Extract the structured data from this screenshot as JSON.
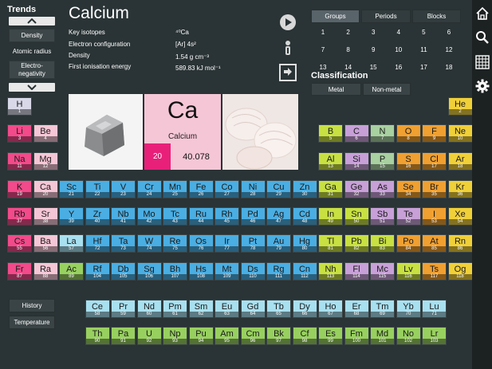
{
  "trends": {
    "title": "Trends",
    "items": [
      "Density",
      "Atomic radius",
      "Electro-negativity"
    ]
  },
  "element": {
    "name": "Calcium",
    "symbol": "Ca",
    "atomic_number": "20",
    "atomic_mass": "40.078",
    "info": [
      {
        "label": "Key isotopes",
        "value": "⁴⁰Ca"
      },
      {
        "label": "Electron configuration",
        "value": "[Ar] 4s²"
      },
      {
        "label": "Density",
        "value": "1.54 g cm⁻³"
      },
      {
        "label": "First ionisation energy",
        "value": "589.83 kJ mol⁻¹"
      }
    ]
  },
  "tabs": [
    "Groups",
    "Periods",
    "Blocks"
  ],
  "active_tab": "Groups",
  "group_numbers": [
    "1",
    "2",
    "3",
    "4",
    "5",
    "6",
    "7",
    "8",
    "9",
    "10",
    "11",
    "12",
    "13",
    "14",
    "15",
    "16",
    "17",
    "18"
  ],
  "classification": {
    "title": "Classification",
    "buttons": [
      "Metal",
      "Non-metal"
    ]
  },
  "bottom_buttons": [
    "History",
    "Temperature"
  ],
  "colors": {
    "alkali": "#f24a8a",
    "alkaline": "#f5c6d6",
    "transition": "#4aaee3",
    "post_transition": "#c8e042",
    "metalloid": "#c8a0d8",
    "nonmetal": "#a8d0a0",
    "halogen": "#f0a030",
    "noble": "#f0d038",
    "lanthanide": "#a8e0f0",
    "actinide": "#98d060",
    "unknown": "#88c8c0",
    "hydrogen": "#d8d8e8"
  },
  "icons": [
    "home-icon",
    "search-icon",
    "grid-icon",
    "gear-icon",
    "play-icon",
    "info-icon",
    "swap-icon"
  ],
  "cells": [
    {
      "s": "H",
      "n": "1",
      "c": "hydrogen",
      "col": 1,
      "row": 1
    },
    {
      "s": "He",
      "n": "2",
      "c": "noble",
      "col": 18,
      "row": 1
    },
    {
      "s": "Li",
      "n": "3",
      "c": "alkali",
      "col": 1,
      "row": 2
    },
    {
      "s": "Be",
      "n": "4",
      "c": "alkaline",
      "col": 2,
      "row": 2
    },
    {
      "s": "B",
      "n": "5",
      "c": "post_transition",
      "col": 13,
      "row": 2
    },
    {
      "s": "C",
      "n": "6",
      "c": "metalloid",
      "col": 14,
      "row": 2
    },
    {
      "s": "N",
      "n": "7",
      "c": "nonmetal",
      "col": 15,
      "row": 2
    },
    {
      "s": "O",
      "n": "8",
      "c": "halogen",
      "col": 16,
      "row": 2
    },
    {
      "s": "F",
      "n": "9",
      "c": "halogen",
      "col": 17,
      "row": 2
    },
    {
      "s": "Ne",
      "n": "10",
      "c": "noble",
      "col": 18,
      "row": 2
    },
    {
      "s": "Na",
      "n": "11",
      "c": "alkali",
      "col": 1,
      "row": 3
    },
    {
      "s": "Mg",
      "n": "12",
      "c": "alkaline",
      "col": 2,
      "row": 3
    },
    {
      "s": "Al",
      "n": "13",
      "c": "post_transition",
      "col": 13,
      "row": 3
    },
    {
      "s": "Si",
      "n": "14",
      "c": "metalloid",
      "col": 14,
      "row": 3
    },
    {
      "s": "P",
      "n": "15",
      "c": "nonmetal",
      "col": 15,
      "row": 3
    },
    {
      "s": "S",
      "n": "16",
      "c": "halogen",
      "col": 16,
      "row": 3
    },
    {
      "s": "Cl",
      "n": "17",
      "c": "halogen",
      "col": 17,
      "row": 3
    },
    {
      "s": "Ar",
      "n": "18",
      "c": "noble",
      "col": 18,
      "row": 3
    },
    {
      "s": "K",
      "n": "19",
      "c": "alkali",
      "col": 1,
      "row": 4
    },
    {
      "s": "Ca",
      "n": "20",
      "c": "alkaline",
      "col": 2,
      "row": 4
    },
    {
      "s": "Sc",
      "n": "21",
      "c": "transition",
      "col": 3,
      "row": 4
    },
    {
      "s": "Ti",
      "n": "22",
      "c": "transition",
      "col": 4,
      "row": 4
    },
    {
      "s": "V",
      "n": "23",
      "c": "transition",
      "col": 5,
      "row": 4
    },
    {
      "s": "Cr",
      "n": "24",
      "c": "transition",
      "col": 6,
      "row": 4
    },
    {
      "s": "Mn",
      "n": "25",
      "c": "transition",
      "col": 7,
      "row": 4
    },
    {
      "s": "Fe",
      "n": "26",
      "c": "transition",
      "col": 8,
      "row": 4
    },
    {
      "s": "Co",
      "n": "27",
      "c": "transition",
      "col": 9,
      "row": 4
    },
    {
      "s": "Ni",
      "n": "28",
      "c": "transition",
      "col": 10,
      "row": 4
    },
    {
      "s": "Cu",
      "n": "29",
      "c": "transition",
      "col": 11,
      "row": 4
    },
    {
      "s": "Zn",
      "n": "30",
      "c": "transition",
      "col": 12,
      "row": 4
    },
    {
      "s": "Ga",
      "n": "31",
      "c": "post_transition",
      "col": 13,
      "row": 4
    },
    {
      "s": "Ge",
      "n": "32",
      "c": "metalloid",
      "col": 14,
      "row": 4
    },
    {
      "s": "As",
      "n": "33",
      "c": "metalloid",
      "col": 15,
      "row": 4
    },
    {
      "s": "Se",
      "n": "34",
      "c": "halogen",
      "col": 16,
      "row": 4
    },
    {
      "s": "Br",
      "n": "35",
      "c": "halogen",
      "col": 17,
      "row": 4
    },
    {
      "s": "Kr",
      "n": "36",
      "c": "noble",
      "col": 18,
      "row": 4
    },
    {
      "s": "Rb",
      "n": "37",
      "c": "alkali",
      "col": 1,
      "row": 5
    },
    {
      "s": "Sr",
      "n": "38",
      "c": "alkaline",
      "col": 2,
      "row": 5
    },
    {
      "s": "Y",
      "n": "39",
      "c": "transition",
      "col": 3,
      "row": 5
    },
    {
      "s": "Zr",
      "n": "40",
      "c": "transition",
      "col": 4,
      "row": 5
    },
    {
      "s": "Nb",
      "n": "41",
      "c": "transition",
      "col": 5,
      "row": 5
    },
    {
      "s": "Mo",
      "n": "42",
      "c": "transition",
      "col": 6,
      "row": 5
    },
    {
      "s": "Tc",
      "n": "43",
      "c": "transition",
      "col": 7,
      "row": 5
    },
    {
      "s": "Ru",
      "n": "44",
      "c": "transition",
      "col": 8,
      "row": 5
    },
    {
      "s": "Rh",
      "n": "45",
      "c": "transition",
      "col": 9,
      "row": 5
    },
    {
      "s": "Pd",
      "n": "46",
      "c": "transition",
      "col": 10,
      "row": 5
    },
    {
      "s": "Ag",
      "n": "47",
      "c": "transition",
      "col": 11,
      "row": 5
    },
    {
      "s": "Cd",
      "n": "48",
      "c": "transition",
      "col": 12,
      "row": 5
    },
    {
      "s": "In",
      "n": "49",
      "c": "post_transition",
      "col": 13,
      "row": 5
    },
    {
      "s": "Sn",
      "n": "50",
      "c": "post_transition",
      "col": 14,
      "row": 5
    },
    {
      "s": "Sb",
      "n": "51",
      "c": "metalloid",
      "col": 15,
      "row": 5
    },
    {
      "s": "Te",
      "n": "52",
      "c": "metalloid",
      "col": 16,
      "row": 5
    },
    {
      "s": "I",
      "n": "53",
      "c": "halogen",
      "col": 17,
      "row": 5
    },
    {
      "s": "Xe",
      "n": "54",
      "c": "noble",
      "col": 18,
      "row": 5
    },
    {
      "s": "Cs",
      "n": "55",
      "c": "alkali",
      "col": 1,
      "row": 6
    },
    {
      "s": "Ba",
      "n": "56",
      "c": "alkaline",
      "col": 2,
      "row": 6
    },
    {
      "s": "La",
      "n": "57",
      "c": "lanthanide",
      "col": 3,
      "row": 6
    },
    {
      "s": "Hf",
      "n": "72",
      "c": "transition",
      "col": 4,
      "row": 6
    },
    {
      "s": "Ta",
      "n": "73",
      "c": "transition",
      "col": 5,
      "row": 6
    },
    {
      "s": "W",
      "n": "74",
      "c": "transition",
      "col": 6,
      "row": 6
    },
    {
      "s": "Re",
      "n": "75",
      "c": "transition",
      "col": 7,
      "row": 6
    },
    {
      "s": "Os",
      "n": "76",
      "c": "transition",
      "col": 8,
      "row": 6
    },
    {
      "s": "Ir",
      "n": "77",
      "c": "transition",
      "col": 9,
      "row": 6
    },
    {
      "s": "Pt",
      "n": "78",
      "c": "transition",
      "col": 10,
      "row": 6
    },
    {
      "s": "Au",
      "n": "79",
      "c": "transition",
      "col": 11,
      "row": 6
    },
    {
      "s": "Hg",
      "n": "80",
      "c": "transition",
      "col": 12,
      "row": 6
    },
    {
      "s": "Tl",
      "n": "81",
      "c": "post_transition",
      "col": 13,
      "row": 6
    },
    {
      "s": "Pb",
      "n": "82",
      "c": "post_transition",
      "col": 14,
      "row": 6
    },
    {
      "s": "Bi",
      "n": "83",
      "c": "post_transition",
      "col": 15,
      "row": 6
    },
    {
      "s": "Po",
      "n": "84",
      "c": "halogen",
      "col": 16,
      "row": 6
    },
    {
      "s": "At",
      "n": "85",
      "c": "halogen",
      "col": 17,
      "row": 6
    },
    {
      "s": "Rn",
      "n": "86",
      "c": "noble",
      "col": 18,
      "row": 6
    },
    {
      "s": "Fr",
      "n": "87",
      "c": "alkali",
      "col": 1,
      "row": 7
    },
    {
      "s": "Ra",
      "n": "88",
      "c": "alkaline",
      "col": 2,
      "row": 7
    },
    {
      "s": "Ac",
      "n": "89",
      "c": "actinide",
      "col": 3,
      "row": 7
    },
    {
      "s": "Rf",
      "n": "104",
      "c": "transition",
      "col": 4,
      "row": 7
    },
    {
      "s": "Db",
      "n": "105",
      "c": "transition",
      "col": 5,
      "row": 7
    },
    {
      "s": "Sg",
      "n": "106",
      "c": "transition",
      "col": 6,
      "row": 7
    },
    {
      "s": "Bh",
      "n": "107",
      "c": "transition",
      "col": 7,
      "row": 7
    },
    {
      "s": "Hs",
      "n": "108",
      "c": "transition",
      "col": 8,
      "row": 7
    },
    {
      "s": "Mt",
      "n": "109",
      "c": "transition",
      "col": 9,
      "row": 7
    },
    {
      "s": "Ds",
      "n": "110",
      "c": "transition",
      "col": 10,
      "row": 7
    },
    {
      "s": "Rg",
      "n": "111",
      "c": "transition",
      "col": 11,
      "row": 7
    },
    {
      "s": "Cn",
      "n": "112",
      "c": "transition",
      "col": 12,
      "row": 7
    },
    {
      "s": "Nh",
      "n": "113",
      "c": "post_transition",
      "col": 13,
      "row": 7
    },
    {
      "s": "Fl",
      "n": "114",
      "c": "metalloid",
      "col": 14,
      "row": 7
    },
    {
      "s": "Mc",
      "n": "115",
      "c": "metalloid",
      "col": 15,
      "row": 7
    },
    {
      "s": "Lv",
      "n": "116",
      "c": "post_transition",
      "col": 16,
      "row": 7
    },
    {
      "s": "Ts",
      "n": "117",
      "c": "halogen",
      "col": 17,
      "row": 7
    },
    {
      "s": "Og",
      "n": "118",
      "c": "noble",
      "col": 18,
      "row": 7
    },
    {
      "s": "Ce",
      "n": "58",
      "c": "lanthanide",
      "col": 4,
      "row": 9
    },
    {
      "s": "Pr",
      "n": "59",
      "c": "lanthanide",
      "col": 5,
      "row": 9
    },
    {
      "s": "Nd",
      "n": "60",
      "c": "lanthanide",
      "col": 6,
      "row": 9
    },
    {
      "s": "Pm",
      "n": "61",
      "c": "lanthanide",
      "col": 7,
      "row": 9
    },
    {
      "s": "Sm",
      "n": "62",
      "c": "lanthanide",
      "col": 8,
      "row": 9
    },
    {
      "s": "Eu",
      "n": "63",
      "c": "lanthanide",
      "col": 9,
      "row": 9
    },
    {
      "s": "Gd",
      "n": "64",
      "c": "lanthanide",
      "col": 10,
      "row": 9
    },
    {
      "s": "Tb",
      "n": "65",
      "c": "lanthanide",
      "col": 11,
      "row": 9
    },
    {
      "s": "Dy",
      "n": "66",
      "c": "lanthanide",
      "col": 12,
      "row": 9
    },
    {
      "s": "Ho",
      "n": "67",
      "c": "lanthanide",
      "col": 13,
      "row": 9
    },
    {
      "s": "Er",
      "n": "68",
      "c": "lanthanide",
      "col": 14,
      "row": 9
    },
    {
      "s": "Tm",
      "n": "69",
      "c": "lanthanide",
      "col": 15,
      "row": 9
    },
    {
      "s": "Yb",
      "n": "70",
      "c": "lanthanide",
      "col": 16,
      "row": 9
    },
    {
      "s": "Lu",
      "n": "71",
      "c": "lanthanide",
      "col": 17,
      "row": 9
    },
    {
      "s": "Th",
      "n": "90",
      "c": "actinide",
      "col": 4,
      "row": 10
    },
    {
      "s": "Pa",
      "n": "91",
      "c": "actinide",
      "col": 5,
      "row": 10
    },
    {
      "s": "U",
      "n": "92",
      "c": "actinide",
      "col": 6,
      "row": 10
    },
    {
      "s": "Np",
      "n": "93",
      "c": "actinide",
      "col": 7,
      "row": 10
    },
    {
      "s": "Pu",
      "n": "94",
      "c": "actinide",
      "col": 8,
      "row": 10
    },
    {
      "s": "Am",
      "n": "95",
      "c": "actinide",
      "col": 9,
      "row": 10
    },
    {
      "s": "Cm",
      "n": "96",
      "c": "actinide",
      "col": 10,
      "row": 10
    },
    {
      "s": "Bk",
      "n": "97",
      "c": "actinide",
      "col": 11,
      "row": 10
    },
    {
      "s": "Cf",
      "n": "98",
      "c": "actinide",
      "col": 12,
      "row": 10
    },
    {
      "s": "Es",
      "n": "99",
      "c": "actinide",
      "col": 13,
      "row": 10
    },
    {
      "s": "Fm",
      "n": "100",
      "c": "actinide",
      "col": 14,
      "row": 10
    },
    {
      "s": "Md",
      "n": "101",
      "c": "actinide",
      "col": 15,
      "row": 10
    },
    {
      "s": "No",
      "n": "102",
      "c": "actinide",
      "col": 16,
      "row": 10
    },
    {
      "s": "Lr",
      "n": "103",
      "c": "actinide",
      "col": 17,
      "row": 10
    }
  ]
}
